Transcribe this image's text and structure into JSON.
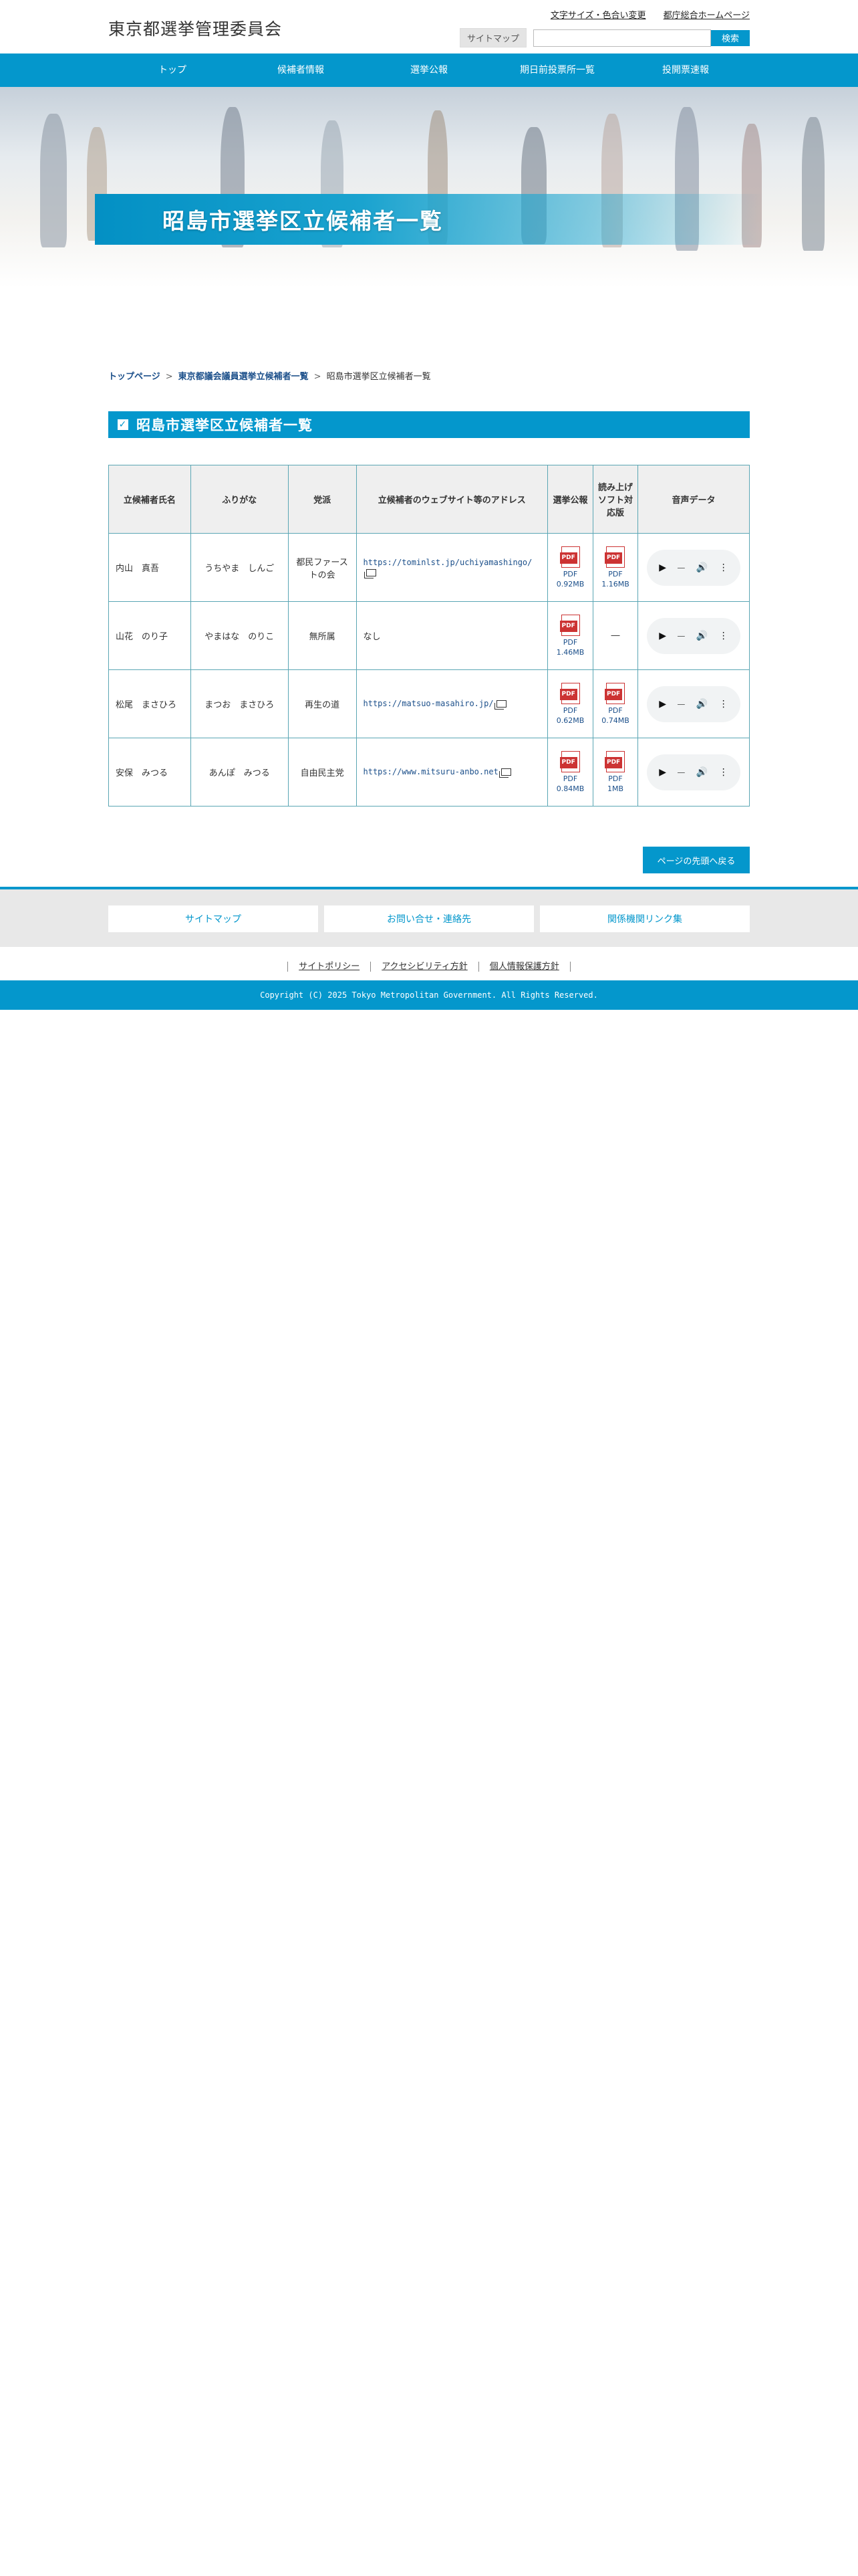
{
  "header": {
    "site_title": "東京都選挙管理委員会",
    "links": [
      "文字サイズ・色合い変更",
      "都庁総合ホームページ"
    ],
    "sitemap_label": "サイトマップ",
    "search_placeholder": "",
    "search_label": "検索"
  },
  "nav": [
    "トップ",
    "候補者情報",
    "選挙公報",
    "期日前投票所一覧",
    "投開票速報"
  ],
  "hero": {
    "title": "昭島市選挙区立候補者一覧"
  },
  "breadcrumb": [
    "トップページ",
    "東京都議会議員選挙立候補者一覧",
    "昭島市選挙区立候補者一覧"
  ],
  "section_title": "昭島市選挙区立候補者一覧",
  "table": {
    "headers": [
      "立候補者氏名",
      "ふりがな",
      "党派",
      "立候補者のウェブサイト等のアドレス",
      "選挙公報",
      "読み上げソフト対応版",
      "音声データ"
    ],
    "rows": [
      {
        "name": "内山　真吾",
        "kana": "うちやま　しんご",
        "party": "都民ファーストの会",
        "url": "https://tominlst.jp/uchiyamashingo/",
        "pdf1": "PDF",
        "pdf1_size": "0.92MB",
        "pdf2": "PDF",
        "pdf2_size": "1.16MB",
        "reader_none": ""
      },
      {
        "name": "山花　のり子",
        "kana": "やまはな　のりこ",
        "party": "無所属",
        "url": "なし",
        "pdf1": "PDF",
        "pdf1_size": "1.46MB",
        "pdf2": "",
        "pdf2_size": "",
        "reader_none": "―"
      },
      {
        "name": "松尾　まさひろ",
        "kana": "まつお　まさひろ",
        "party": "再生の道",
        "url": "https://matsuo-masahiro.jp/",
        "pdf1": "PDF",
        "pdf1_size": "0.62MB",
        "pdf2": "PDF",
        "pdf2_size": "0.74MB",
        "reader_none": ""
      },
      {
        "name": "安保　みつる",
        "kana": "あんぽ　みつる",
        "party": "自由民主党",
        "url": "https://www.mitsuru-anbo.net",
        "pdf1": "PDF",
        "pdf1_size": "0.84MB",
        "pdf2": "PDF",
        "pdf2_size": "1MB",
        "reader_none": ""
      }
    ]
  },
  "back_to_top": "ページの先頭へ戻る",
  "footer": {
    "links": [
      "サイトマップ",
      "お問い合せ・連絡先",
      "関係機関リンク集"
    ],
    "policies": [
      "サイトポリシー",
      "アクセシビリティ方針",
      "個人情報保護方針"
    ],
    "copyright": "Copyright (C) 2025 Tokyo Metropolitan Government. All Rights Reserved."
  },
  "colors": {
    "accent": "#0497cc",
    "table_border": "#5aa6b4",
    "link": "#1b4f8a"
  }
}
